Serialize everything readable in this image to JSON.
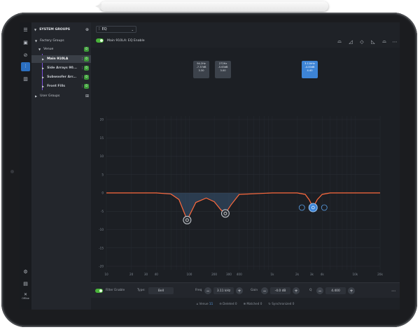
{
  "sidebar": {
    "header": "SYSTEM GROUPS",
    "items": [
      {
        "label": "Factory Groups"
      },
      {
        "label": "Venue"
      },
      {
        "label": "Main 910LA"
      },
      {
        "label": "Side Arrays 90..."
      },
      {
        "label": "Subwoofer Arr..."
      },
      {
        "label": "Front Fills"
      },
      {
        "label": "User Groups"
      }
    ],
    "bottom_label": "Offline"
  },
  "topbar": {
    "view_label": "EQ"
  },
  "eq": {
    "enable_label": "Main 910LA: EQ Enable",
    "bands": [
      {
        "freq": "94.2Hz",
        "gain": "-7.37dB",
        "q": "3.30"
      },
      {
        "freq": "272Hz",
        "gain": "-5.63dB",
        "q": "3.00"
      },
      {
        "freq": "3.11kHz",
        "gain": "-4.00dB",
        "q": "4.40"
      }
    ]
  },
  "axes": {
    "y_ticks": [
      "20",
      "15",
      "10",
      "5",
      "0",
      "-5",
      "-10",
      "-15",
      "-20"
    ],
    "x_ticks": [
      "10",
      "20",
      "30",
      "40",
      "100",
      "200",
      "300",
      "400",
      "1k",
      "2k",
      "3k",
      "4k",
      "10k",
      "20k"
    ]
  },
  "footer": {
    "filter_enable": "Filter Enable",
    "type_label": "Type:",
    "type_value": "Bell",
    "freq_label": "Freq",
    "freq_value": "3.11 kHz",
    "gain_label": "Gain",
    "gain_value": "-4.0 dB",
    "q_label": "Q",
    "q_value": "4.400"
  },
  "status": {
    "venue": "Venue",
    "venue_count": "11",
    "deleted": "Deleted 0",
    "matched": "Matched 0",
    "synchronized": "Synchronized 0"
  },
  "colors": {
    "accent": "#2b6fc0",
    "curve": "#ff6a3d",
    "enable": "#49b33a",
    "selected_point": "#3d84d6"
  },
  "chart_data": {
    "type": "line",
    "title": "",
    "xlabel": "",
    "ylabel": "",
    "xscale": "log",
    "xlim": [
      10,
      20000
    ],
    "ylim": [
      -20,
      20
    ],
    "grid": true,
    "series": [
      {
        "x": [
          10,
          40,
          60,
          75,
          94.2,
          120,
          160,
          200,
          240,
          272,
          320,
          400,
          1000,
          2000,
          2500,
          2800,
          3110,
          3500,
          4000,
          5000,
          10000,
          20000
        ],
        "y": [
          0,
          0,
          -0.3,
          -1.8,
          -7.4,
          -2.6,
          -1.4,
          -2.4,
          -4.6,
          -5.6,
          -3.2,
          -0.4,
          0,
          0,
          -0.4,
          -1.9,
          -4.0,
          -1.8,
          -0.4,
          0,
          0,
          0
        ]
      }
    ],
    "points": [
      {
        "x": 94.2,
        "y": -7.4
      },
      {
        "x": 272,
        "y": -5.6
      },
      {
        "x": 3110,
        "y": -4.0
      }
    ]
  }
}
